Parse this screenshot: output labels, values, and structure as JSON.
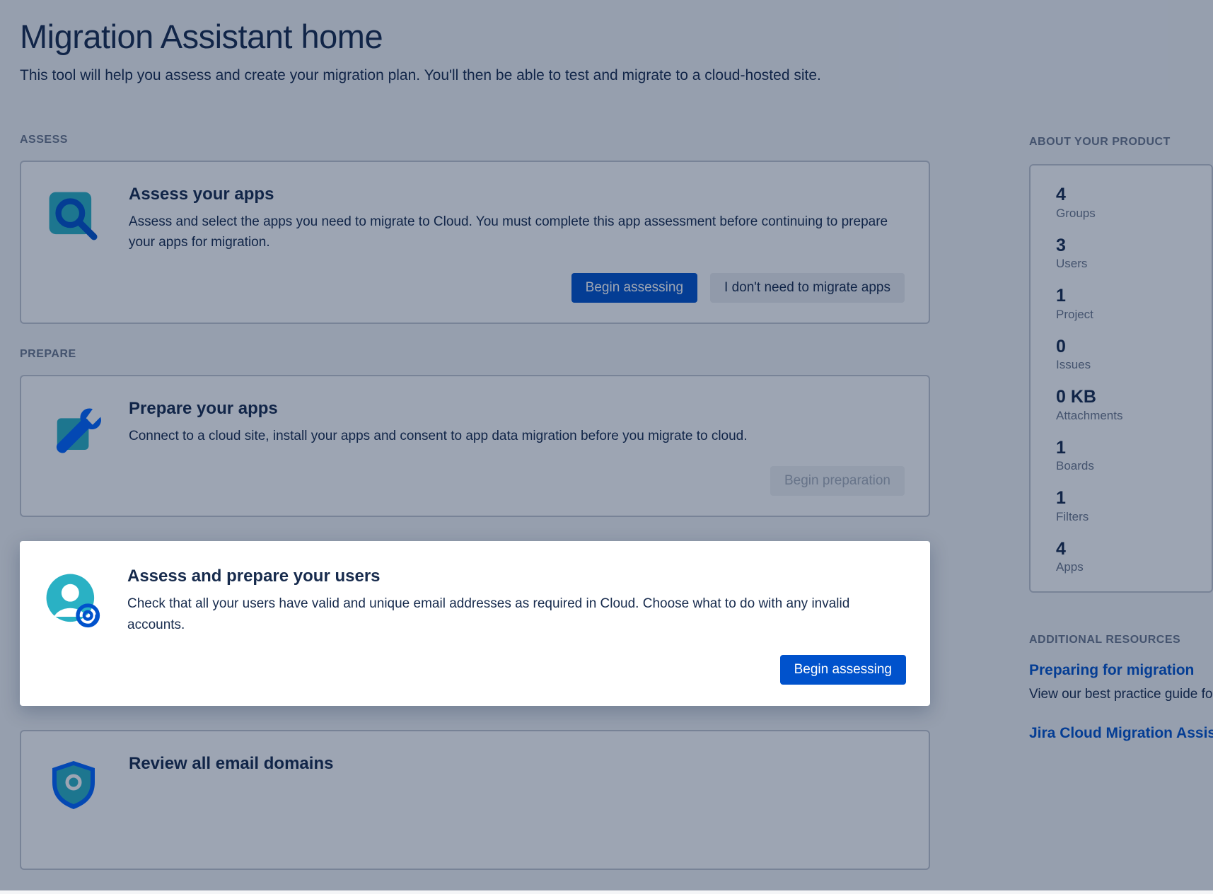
{
  "header": {
    "title": "Migration Assistant home",
    "subtitle": "This tool will help you assess and create your migration plan. You'll then be able to test and migrate to a cloud-hosted site."
  },
  "sections": {
    "assess_label": "ASSESS",
    "prepare_label": "PREPARE"
  },
  "cards": {
    "assess_apps": {
      "title": "Assess your apps",
      "desc": "Assess and select the apps you need to migrate to Cloud. You must complete this app assessment before continuing to prepare your apps for migration.",
      "primary": "Begin assessing",
      "secondary": "I don't need to migrate apps"
    },
    "prepare_apps": {
      "title": "Prepare your apps",
      "desc": "Connect to a cloud site, install your apps and consent to app data migration before you migrate to cloud.",
      "primary": "Begin preparation"
    },
    "assess_users": {
      "title": "Assess and prepare your users",
      "desc": "Check that all your users have valid and unique email addresses as required in Cloud. Choose what to do with any invalid accounts.",
      "primary": "Begin assessing"
    },
    "review_domains": {
      "title": "Review all email domains"
    }
  },
  "sidebar": {
    "about_label": "ABOUT YOUR PRODUCT",
    "stats": [
      {
        "value": "4",
        "label": "Groups"
      },
      {
        "value": "3",
        "label": "Users"
      },
      {
        "value": "1",
        "label": "Project"
      },
      {
        "value": "0",
        "label": "Issues"
      },
      {
        "value": "0 KB",
        "label": "Attachments"
      },
      {
        "value": "1",
        "label": "Boards"
      },
      {
        "value": "1",
        "label": "Filters"
      },
      {
        "value": "4",
        "label": "Apps"
      }
    ],
    "resources_label": "ADDITIONAL RESOURCES",
    "resources": [
      {
        "title": "Preparing for migration",
        "desc": "View our best practice guide for information on app migration, pre-migration testing, and post-migration."
      },
      {
        "title": "Jira Cloud Migration Assistant"
      }
    ]
  }
}
